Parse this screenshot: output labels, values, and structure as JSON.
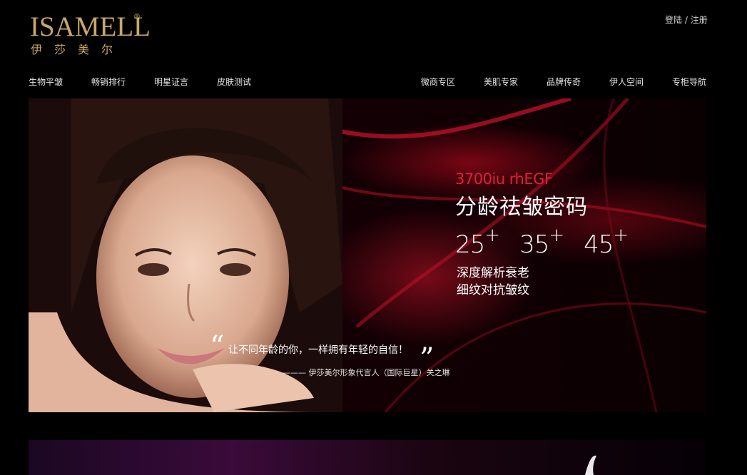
{
  "brand": {
    "logo_text": "ISAMELL",
    "logo_reg": "®",
    "logo_sub": "伊莎美尔",
    "gold": "#c8a86a"
  },
  "auth": {
    "login": "登陆",
    "sep": " / ",
    "register": "注册"
  },
  "nav_left": [
    {
      "label": "生物平皱"
    },
    {
      "label": "畅销排行"
    },
    {
      "label": "明星证言"
    },
    {
      "label": "皮肤测试"
    }
  ],
  "nav_right": [
    {
      "label": "微商专区"
    },
    {
      "label": "美肌专家"
    },
    {
      "label": "品牌传奇"
    },
    {
      "label": "伊人空间"
    },
    {
      "label": "专柜导航"
    }
  ],
  "banner": {
    "headline_en": "3700iu rhEGF",
    "headline_cn": "分龄祛皱密码",
    "ages": [
      {
        "num": "25",
        "plus": "+"
      },
      {
        "num": "35",
        "plus": "+"
      },
      {
        "num": "45",
        "plus": "+"
      }
    ],
    "desc_line1": "深度解析衰老",
    "desc_line2": "细纹对抗皱纹",
    "quote_open": "“",
    "quote_text": "让不同年龄的你，一样拥有年轻的自信！",
    "quote_close": "”",
    "quote_attr": "——— 伊莎美尔形象代言人（国际巨星）关之琳",
    "accent": "#e0203a"
  }
}
